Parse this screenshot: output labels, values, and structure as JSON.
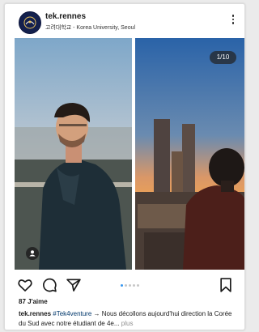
{
  "post": {
    "username": "tek.rennes",
    "location": "고려대학교 - Korea University, Seoul",
    "avatar_colors": {
      "bg": "#13204d",
      "accent": "#e8c25a"
    },
    "image_counter": "1/10",
    "likes": "87 J'aime",
    "caption": {
      "username": "tek.rennes",
      "hashtag": "#Tek4venture",
      "text": " → Nous décollons aujourd'hui direction la Corée du Sud avec notre étudiant de 4e...",
      "more": "plus"
    },
    "carousel": {
      "count": 5,
      "active": 0
    },
    "icons": {
      "more": "more-vertical-icon",
      "like": "heart-icon",
      "comment": "comment-icon",
      "share": "send-icon",
      "save": "bookmark-icon",
      "tag": "user-tag-icon"
    },
    "accent_color": "#3897f0"
  }
}
